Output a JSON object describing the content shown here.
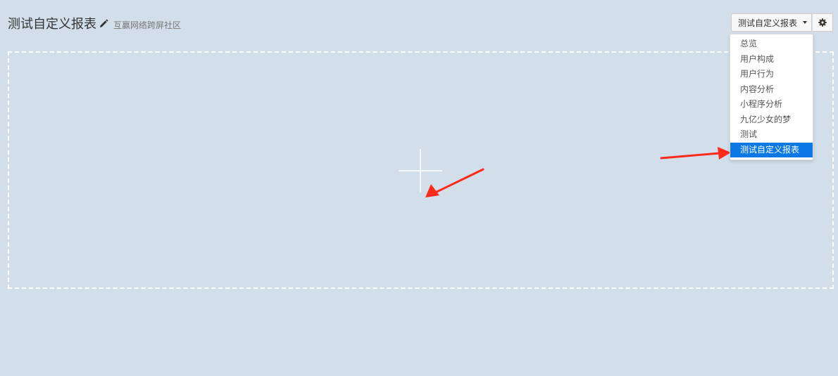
{
  "header": {
    "title": "测试自定义报表",
    "subtitle": "互赢网络跨屏社区",
    "edit_icon": "pencil-icon"
  },
  "toolbar": {
    "selected_report": "测试自定义报表",
    "settings_icon": "gear-icon"
  },
  "dropdown": {
    "items": [
      {
        "label": "总览",
        "active": false
      },
      {
        "label": "用户构成",
        "active": false
      },
      {
        "label": "用户行为",
        "active": false
      },
      {
        "label": "内容分析",
        "active": false
      },
      {
        "label": "小程序分析",
        "active": false
      },
      {
        "label": "九亿少女的梦",
        "active": false
      },
      {
        "label": "测试",
        "active": false
      },
      {
        "label": "测试自定义报表",
        "active": true
      }
    ]
  },
  "canvas": {
    "add_icon": "plus-icon"
  },
  "colors": {
    "background": "#d2dfea",
    "active_item": "#0b78e3",
    "annotation_arrow": "#ff2a1a"
  }
}
